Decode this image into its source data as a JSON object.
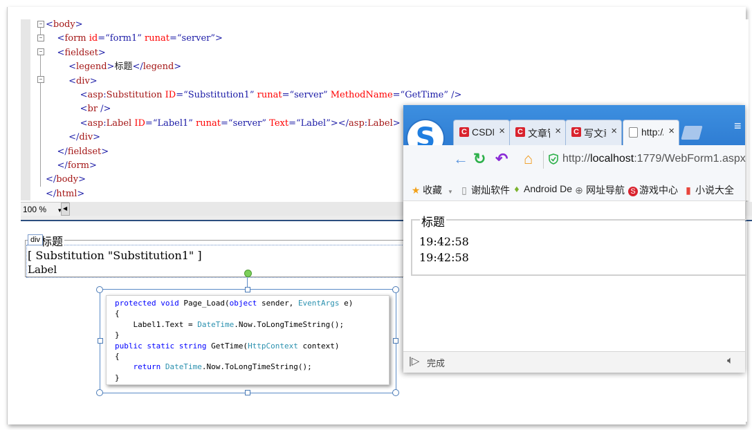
{
  "editor": {
    "lines": [
      {
        "indent": "",
        "parts": [
          {
            "t": "<",
            "c": "blue"
          },
          {
            "t": "body",
            "c": "mar"
          },
          {
            "t": ">",
            "c": "blue"
          }
        ]
      },
      {
        "indent": "    ",
        "parts": [
          {
            "t": "<",
            "c": "blue"
          },
          {
            "t": "form",
            "c": "mar"
          },
          {
            "t": " id",
            "c": "red"
          },
          {
            "t": "=",
            "c": "blue"
          },
          {
            "t": "“form1”",
            "c": "blue"
          },
          {
            "t": " runat",
            "c": "red"
          },
          {
            "t": "=",
            "c": "blue"
          },
          {
            "t": "“server”",
            "c": "blue"
          },
          {
            "t": ">",
            "c": "blue"
          }
        ]
      },
      {
        "indent": "    ",
        "parts": [
          {
            "t": "<",
            "c": "blue"
          },
          {
            "t": "fieldset",
            "c": "mar"
          },
          {
            "t": ">",
            "c": "blue"
          }
        ]
      },
      {
        "indent": "        ",
        "parts": [
          {
            "t": "<",
            "c": "blue"
          },
          {
            "t": "legend",
            "c": "mar"
          },
          {
            "t": ">",
            "c": "blue"
          },
          {
            "t": "标题",
            "c": "blk"
          },
          {
            "t": "</",
            "c": "blue"
          },
          {
            "t": "legend",
            "c": "mar"
          },
          {
            "t": ">",
            "c": "blue"
          }
        ]
      },
      {
        "indent": "        ",
        "parts": [
          {
            "t": "<",
            "c": "blue"
          },
          {
            "t": "div",
            "c": "mar"
          },
          {
            "t": ">",
            "c": "blue"
          }
        ]
      },
      {
        "indent": "            ",
        "parts": [
          {
            "t": "<",
            "c": "blue"
          },
          {
            "t": "asp",
            "c": "mar"
          },
          {
            "t": ":",
            "c": "blue"
          },
          {
            "t": "Substitution",
            "c": "mar"
          },
          {
            "t": " ID",
            "c": "red"
          },
          {
            "t": "=",
            "c": "blue"
          },
          {
            "t": "“Substitution1”",
            "c": "blue"
          },
          {
            "t": " runat",
            "c": "red"
          },
          {
            "t": "=",
            "c": "blue"
          },
          {
            "t": "“server”",
            "c": "blue"
          },
          {
            "t": " MethodName",
            "c": "red"
          },
          {
            "t": "=",
            "c": "blue"
          },
          {
            "t": "“GetTime”",
            "c": "blue"
          },
          {
            "t": " />",
            "c": "blue"
          }
        ]
      },
      {
        "indent": "            ",
        "parts": [
          {
            "t": "<",
            "c": "blue"
          },
          {
            "t": "br",
            "c": "mar"
          },
          {
            "t": " />",
            "c": "blue"
          }
        ]
      },
      {
        "indent": "            ",
        "parts": [
          {
            "t": "<",
            "c": "blue"
          },
          {
            "t": "asp",
            "c": "mar"
          },
          {
            "t": ":",
            "c": "blue"
          },
          {
            "t": "Label",
            "c": "mar"
          },
          {
            "t": " ID",
            "c": "red"
          },
          {
            "t": "=",
            "c": "blue"
          },
          {
            "t": "“Label1”",
            "c": "blue"
          },
          {
            "t": " runat",
            "c": "red"
          },
          {
            "t": "=",
            "c": "blue"
          },
          {
            "t": "“server”",
            "c": "blue"
          },
          {
            "t": " Text",
            "c": "red"
          },
          {
            "t": "=",
            "c": "blue"
          },
          {
            "t": "“Label”",
            "c": "blue"
          },
          {
            "t": "></",
            "c": "blue"
          },
          {
            "t": "asp",
            "c": "mar"
          },
          {
            "t": ":",
            "c": "blue"
          },
          {
            "t": "Label",
            "c": "mar"
          },
          {
            "t": ">",
            "c": "blue"
          }
        ]
      },
      {
        "indent": "        ",
        "parts": [
          {
            "t": "</",
            "c": "blue"
          },
          {
            "t": "div",
            "c": "mar"
          },
          {
            "t": ">",
            "c": "blue"
          }
        ]
      },
      {
        "indent": "    ",
        "parts": [
          {
            "t": "</",
            "c": "blue"
          },
          {
            "t": "fieldset",
            "c": "mar"
          },
          {
            "t": ">",
            "c": "blue"
          }
        ]
      },
      {
        "indent": "    ",
        "parts": [
          {
            "t": "</",
            "c": "blue"
          },
          {
            "t": "form",
            "c": "mar"
          },
          {
            "t": ">",
            "c": "blue"
          }
        ]
      },
      {
        "indent": "",
        "parts": [
          {
            "t": "</",
            "c": "blue"
          },
          {
            "t": "body",
            "c": "mar"
          },
          {
            "t": ">",
            "c": "blue"
          }
        ]
      },
      {
        "indent": "",
        "parts": [
          {
            "t": "</",
            "c": "blue"
          },
          {
            "t": "html",
            "c": "mar"
          },
          {
            "t": ">",
            "c": "blue"
          }
        ]
      }
    ],
    "zoom": "100 %"
  },
  "design": {
    "div_tag": "div",
    "legend": "标题",
    "substitution": "[ Substitution \"Substitution1\" ]",
    "label": "Label"
  },
  "codecard": {
    "lines": [
      {
        "indent": "",
        "parts": [
          {
            "t": "protected void ",
            "c": "kw"
          },
          {
            "t": "Page_Load(",
            "c": ""
          },
          {
            "t": "object",
            "c": "kw"
          },
          {
            "t": " sender, ",
            "c": ""
          },
          {
            "t": "EventArgs",
            "c": "ty"
          },
          {
            "t": " e)",
            "c": ""
          }
        ]
      },
      {
        "indent": "",
        "parts": [
          {
            "t": "{",
            "c": ""
          }
        ]
      },
      {
        "indent": "    ",
        "parts": [
          {
            "t": "Label1.Text = ",
            "c": ""
          },
          {
            "t": "DateTime",
            "c": "ty"
          },
          {
            "t": ".Now.ToLongTimeString();",
            "c": ""
          }
        ]
      },
      {
        "indent": "",
        "parts": [
          {
            "t": "}",
            "c": ""
          }
        ]
      },
      {
        "indent": "",
        "parts": [
          {
            "t": "public static string ",
            "c": "kw"
          },
          {
            "t": "GetTime(",
            "c": ""
          },
          {
            "t": "HttpContext",
            "c": "ty"
          },
          {
            "t": " context)",
            "c": ""
          }
        ]
      },
      {
        "indent": "",
        "parts": [
          {
            "t": "{",
            "c": ""
          }
        ]
      },
      {
        "indent": "    ",
        "parts": [
          {
            "t": "return ",
            "c": "kw"
          },
          {
            "t": "DateTime",
            "c": "ty"
          },
          {
            "t": ".Now.ToLongTimeString();",
            "c": ""
          }
        ]
      },
      {
        "indent": "",
        "parts": [
          {
            "t": "}",
            "c": ""
          }
        ]
      }
    ]
  },
  "browser": {
    "logo": "S",
    "tabs": [
      {
        "icon": "C",
        "label": "CSDN",
        "close": "×"
      },
      {
        "icon": "C",
        "label": "文章管",
        "close": "×"
      },
      {
        "icon": "C",
        "label": "写文章",
        "close": "×"
      },
      {
        "icon": "page-icon",
        "label": "http://",
        "close": "×"
      }
    ],
    "menu_icon": "≡",
    "nav": {
      "back": "←",
      "reload": "↻",
      "undo": "↶",
      "home": "⌂"
    },
    "url_prefix": "http://",
    "url_host": "localhost",
    "url_rest": ":1779/WebForm1.aspx",
    "bookmarks": [
      {
        "icon": "★",
        "label": "收藏"
      },
      {
        "icon": "▯",
        "label": "谢灿软件"
      },
      {
        "icon": "♦",
        "label": "Android De"
      },
      {
        "icon": "⊕",
        "label": "网址导航"
      },
      {
        "icon": "S",
        "label": "游戏中心"
      },
      {
        "icon": "▮",
        "label": "小说大全"
      }
    ],
    "page_legend": "标题",
    "time1": "19:42:58",
    "time2": "19:42:58",
    "status": "完成"
  },
  "colors": {
    "accent": "#2f7dd3",
    "tab_icon": "#d9232e"
  }
}
